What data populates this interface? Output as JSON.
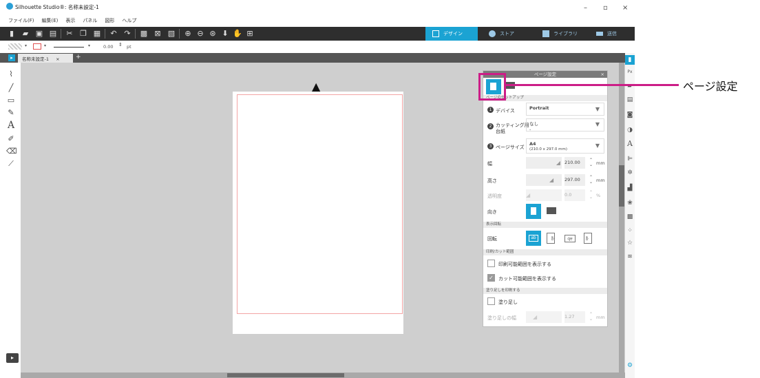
{
  "window": {
    "title": "Silhouette Studio®: 名称未設定-1"
  },
  "menu": [
    "ファイル(F)",
    "編集(E)",
    "表示",
    "パネル",
    "図形",
    "ヘルプ"
  ],
  "nav_tabs": [
    {
      "label": "デザイン",
      "active": true
    },
    {
      "label": "ストア",
      "active": false
    },
    {
      "label": "ライブラリ",
      "active": false
    },
    {
      "label": "送信",
      "active": false
    }
  ],
  "subbar": {
    "line_width": "0.00",
    "unit": "pt"
  },
  "doc_tab": {
    "label": "名称未設定-1",
    "close": "×",
    "add": "+"
  },
  "panel": {
    "title": "ページ設定",
    "close": "×",
    "section_setup": "ページのセットアップ",
    "device_label": "デバイス",
    "device_value": "Portrait",
    "mat_label_1": "カッティング用",
    "mat_label_2": "台紙",
    "mat_value": "なし",
    "mat_value_sub": "-",
    "size_label": "ページサイズ",
    "size_value": "A4",
    "size_sub": "(210.0 x 297.0 mm)",
    "width_label": "幅",
    "width_value": "210.00",
    "height_label": "高さ",
    "height_value": "297.00",
    "opacity_label": "透明度",
    "opacity_value": "0.0",
    "percent": "%",
    "mm": "mm",
    "orient_label": "向き",
    "section_view": "表示回転",
    "rotate_label": "回転",
    "section_print": "印刷/カット範囲",
    "show_print": "印刷可能範囲を表示する",
    "show_cut": "カット可能範囲を表示する",
    "section_bleed": "塗り足しを印刷する",
    "bleed_label": "塗り足し",
    "bleed_width_label": "塗り足しの幅",
    "bleed_width_value": "1.27",
    "num1": "1",
    "num2": "2",
    "num3": "3",
    "rot_1": "ab",
    "rot_2": "ab",
    "rot_3": "ab",
    "rot_4": "ab"
  },
  "callout": {
    "label": "ページ設定"
  },
  "accent": "#1ba3d3",
  "highlight": "#cc1d87"
}
